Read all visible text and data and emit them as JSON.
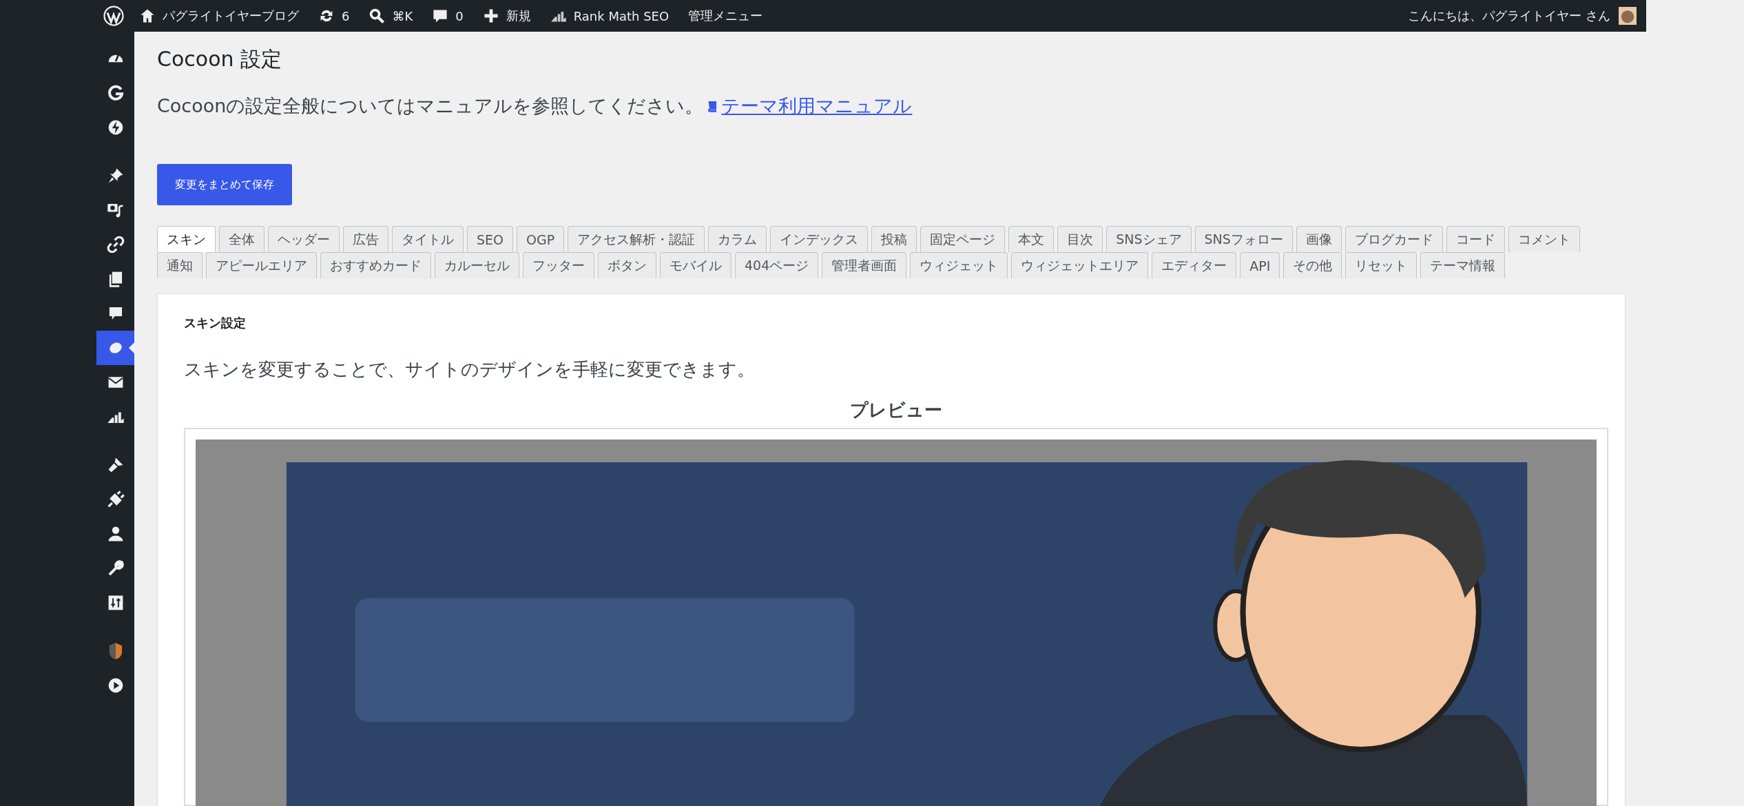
{
  "admin_bar": {
    "items": [
      {
        "label": "パグライトイヤーブログ"
      },
      {
        "label": "6"
      },
      {
        "label": "⌘K"
      },
      {
        "label": "0"
      },
      {
        "label": "新規"
      },
      {
        "label": "Rank Math SEO"
      },
      {
        "label": "管理メニュー"
      }
    ],
    "greeting": "こんにちは、パグライトイヤー さん"
  },
  "sidebar": {
    "groups": [
      {
        "items": [
          {
            "selected": false
          },
          {
            "selected": false
          },
          {
            "selected": false
          }
        ]
      },
      {
        "items": [
          {
            "selected": false
          },
          {
            "selected": false
          },
          {
            "selected": false
          },
          {
            "selected": false
          },
          {
            "selected": false
          },
          {
            "selected": true
          },
          {
            "selected": false
          },
          {
            "selected": false
          }
        ]
      },
      {
        "items": [
          {
            "selected": false
          },
          {
            "selected": false
          },
          {
            "selected": false
          },
          {
            "selected": false
          },
          {
            "selected": false
          }
        ]
      },
      {
        "items": [
          {
            "selected": false
          },
          {
            "selected": false
          }
        ]
      }
    ]
  },
  "page": {
    "title": "Cocoon 設定",
    "intro": "Cocoonの設定全般についてはマニュアルを参照してください。",
    "manual_link": "テーマ利用マニュアル",
    "save_button": "変更をまとめて保存"
  },
  "tab_rows": [
    [
      {
        "label": "スキン",
        "selected": true
      },
      {
        "label": "全体",
        "selected": false
      },
      {
        "label": "ヘッダー",
        "selected": false
      },
      {
        "label": "広告",
        "selected": false
      },
      {
        "label": "タイトル",
        "selected": false
      },
      {
        "label": "SEO",
        "selected": false
      },
      {
        "label": "OGP",
        "selected": false
      },
      {
        "label": "アクセス解析・認証",
        "selected": false
      },
      {
        "label": "カラム",
        "selected": false
      },
      {
        "label": "インデックス",
        "selected": false
      },
      {
        "label": "投稿",
        "selected": false
      },
      {
        "label": "固定ページ",
        "selected": false
      },
      {
        "label": "本文",
        "selected": false
      },
      {
        "label": "目次",
        "selected": false
      },
      {
        "label": "SNSシェア",
        "selected": false
      },
      {
        "label": "SNSフォロー",
        "selected": false
      },
      {
        "label": "画像",
        "selected": false
      },
      {
        "label": "ブログカード",
        "selected": false
      },
      {
        "label": "コード",
        "selected": false
      },
      {
        "label": "コメント",
        "selected": false
      }
    ],
    [
      {
        "label": "通知",
        "selected": false
      },
      {
        "label": "アピールエリア",
        "selected": false
      },
      {
        "label": "おすすめカード",
        "selected": false
      },
      {
        "label": "カルーセル",
        "selected": false
      },
      {
        "label": "フッター",
        "selected": false
      },
      {
        "label": "ボタン",
        "selected": false
      },
      {
        "label": "モバイル",
        "selected": false
      },
      {
        "label": "404ページ",
        "selected": false
      },
      {
        "label": "管理者画面",
        "selected": false
      },
      {
        "label": "ウィジェット",
        "selected": false
      },
      {
        "label": "ウィジェットエリア",
        "selected": false
      },
      {
        "label": "エディター",
        "selected": false
      },
      {
        "label": "API",
        "selected": false
      },
      {
        "label": "その他",
        "selected": false
      },
      {
        "label": "リセット",
        "selected": false
      },
      {
        "label": "テーマ情報",
        "selected": false
      }
    ]
  ],
  "panel": {
    "heading": "スキン設定",
    "description": "スキンを変更することで、サイトのデザインを手軽に変更できます。",
    "preview_label": "プレビュー"
  }
}
